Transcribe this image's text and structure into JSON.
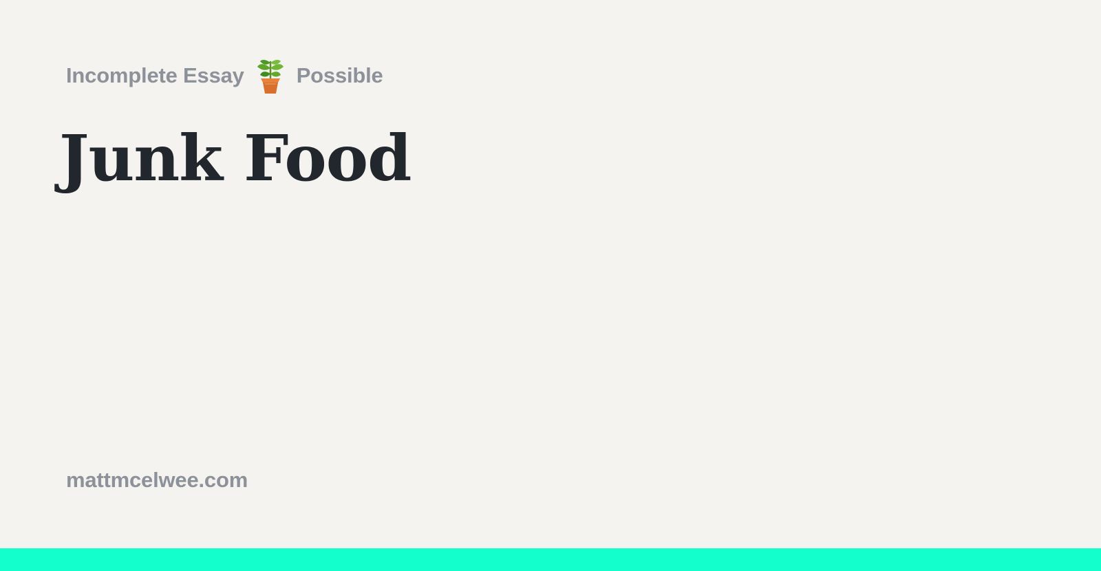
{
  "header": {
    "category_left": "Incomplete Essay",
    "category_right": "Possible",
    "icon": "potted-plant-icon"
  },
  "article": {
    "title": "Junk Food"
  },
  "footer": {
    "domain": "mattmcelwee.com"
  },
  "colors": {
    "background": "#f4f3ef",
    "title": "#22272e",
    "muted_text": "#8d9199",
    "accent_bar": "#13ffcc"
  }
}
